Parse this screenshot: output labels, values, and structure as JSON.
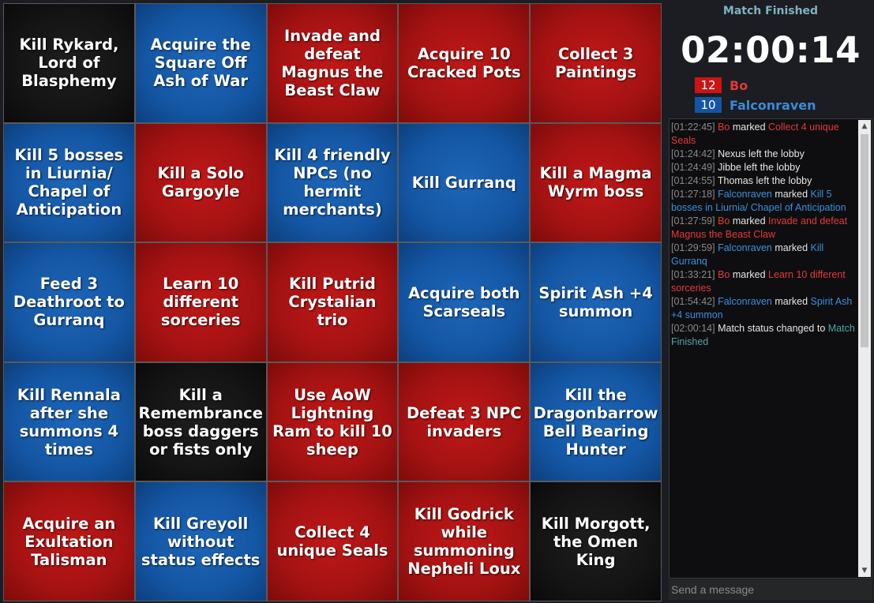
{
  "board": {
    "cells": [
      {
        "text": "Kill Rykard, Lord of Blasphemy",
        "color": "black"
      },
      {
        "text": "Acquire the Square Off Ash of War",
        "color": "blue"
      },
      {
        "text": "Invade and defeat Magnus the Beast Claw",
        "color": "red"
      },
      {
        "text": "Acquire 10 Cracked Pots",
        "color": "red"
      },
      {
        "text": "Collect 3 Paintings",
        "color": "red"
      },
      {
        "text": "Kill 5 bosses in Liurnia/ Chapel of Anticipation",
        "color": "blue"
      },
      {
        "text": "Kill a Solo Gargoyle",
        "color": "red"
      },
      {
        "text": "Kill 4 friendly NPCs (no hermit merchants)",
        "color": "blue"
      },
      {
        "text": "Kill Gurranq",
        "color": "blue"
      },
      {
        "text": "Kill a Magma Wyrm boss",
        "color": "red"
      },
      {
        "text": "Feed 3 Deathroot to Gurranq",
        "color": "blue"
      },
      {
        "text": "Learn 10 different sorceries",
        "color": "red"
      },
      {
        "text": "Kill Putrid Crystalian trio",
        "color": "red"
      },
      {
        "text": "Acquire both Scarseals",
        "color": "blue"
      },
      {
        "text": "Spirit Ash +4 summon",
        "color": "blue"
      },
      {
        "text": "Kill Rennala after she summons 4 times",
        "color": "blue"
      },
      {
        "text": "Kill a Remembrance boss daggers or fists only",
        "color": "black"
      },
      {
        "text": "Use AoW Lightning Ram to kill 10 sheep",
        "color": "red"
      },
      {
        "text": "Defeat 3 NPC invaders",
        "color": "red"
      },
      {
        "text": "Kill the Dragonbarrow Bell Bearing Hunter",
        "color": "blue"
      },
      {
        "text": "Acquire an Exultation Talisman",
        "color": "red"
      },
      {
        "text": "Kill Greyoll without status effects",
        "color": "blue"
      },
      {
        "text": "Collect 4 unique Seals",
        "color": "red"
      },
      {
        "text": "Kill Godrick while summoning Nepheli Loux",
        "color": "red"
      },
      {
        "text": "Kill Morgott, the Omen King",
        "color": "black"
      }
    ]
  },
  "match": {
    "status": "Match Finished",
    "timer": "02:00:14"
  },
  "players": [
    {
      "name": "Bo",
      "score": "12",
      "color": "#cc1414"
    },
    {
      "name": "Falconraven",
      "score": "10",
      "color": "#1456a3"
    }
  ],
  "chat": {
    "lines": [
      [
        {
          "t": "[01:22:45] ",
          "c": "ts"
        },
        {
          "t": "Bo",
          "c": "red-t"
        },
        {
          "t": " marked ",
          "c": ""
        },
        {
          "t": "Collect 4 unique Seals",
          "c": "red-t"
        }
      ],
      [
        {
          "t": "[01:24:42] ",
          "c": "ts"
        },
        {
          "t": "Nexus left the lobby",
          "c": ""
        }
      ],
      [
        {
          "t": "[01:24:49] ",
          "c": "ts"
        },
        {
          "t": "Jibbe left the lobby",
          "c": ""
        }
      ],
      [
        {
          "t": "[01:24:55] ",
          "c": "ts"
        },
        {
          "t": "Thomas left the lobby",
          "c": ""
        }
      ],
      [
        {
          "t": "[01:27:18] ",
          "c": "ts"
        },
        {
          "t": "Falconraven",
          "c": "blue-t"
        },
        {
          "t": " marked ",
          "c": ""
        },
        {
          "t": "Kill 5 bosses in Liurnia/ Chapel of Anticipation",
          "c": "blue-t"
        }
      ],
      [
        {
          "t": "[01:27:59] ",
          "c": "ts"
        },
        {
          "t": "Bo",
          "c": "red-t"
        },
        {
          "t": " marked ",
          "c": ""
        },
        {
          "t": "Invade and defeat Magnus the Beast Claw",
          "c": "red-t"
        }
      ],
      [
        {
          "t": "[01:29:59] ",
          "c": "ts"
        },
        {
          "t": "Falconraven",
          "c": "blue-t"
        },
        {
          "t": " marked ",
          "c": ""
        },
        {
          "t": "Kill Gurranq",
          "c": "blue-t"
        }
      ],
      [
        {
          "t": "[01:33:21] ",
          "c": "ts"
        },
        {
          "t": "Bo",
          "c": "red-t"
        },
        {
          "t": " marked ",
          "c": ""
        },
        {
          "t": "Learn 10 different sorceries",
          "c": "red-t"
        }
      ],
      [
        {
          "t": "[01:54:42] ",
          "c": "ts"
        },
        {
          "t": "Falconraven",
          "c": "blue-t"
        },
        {
          "t": " marked ",
          "c": ""
        },
        {
          "t": "Spirit Ash +4 summon",
          "c": "blue-t"
        }
      ],
      [
        {
          "t": "[02:00:14] ",
          "c": "ts"
        },
        {
          "t": "Match status changed to ",
          "c": ""
        },
        {
          "t": "Match Finished",
          "c": "teal-t"
        }
      ]
    ],
    "input_placeholder": "Send a message",
    "scroll_up_icon": "▲",
    "scroll_down_icon": "▼"
  }
}
